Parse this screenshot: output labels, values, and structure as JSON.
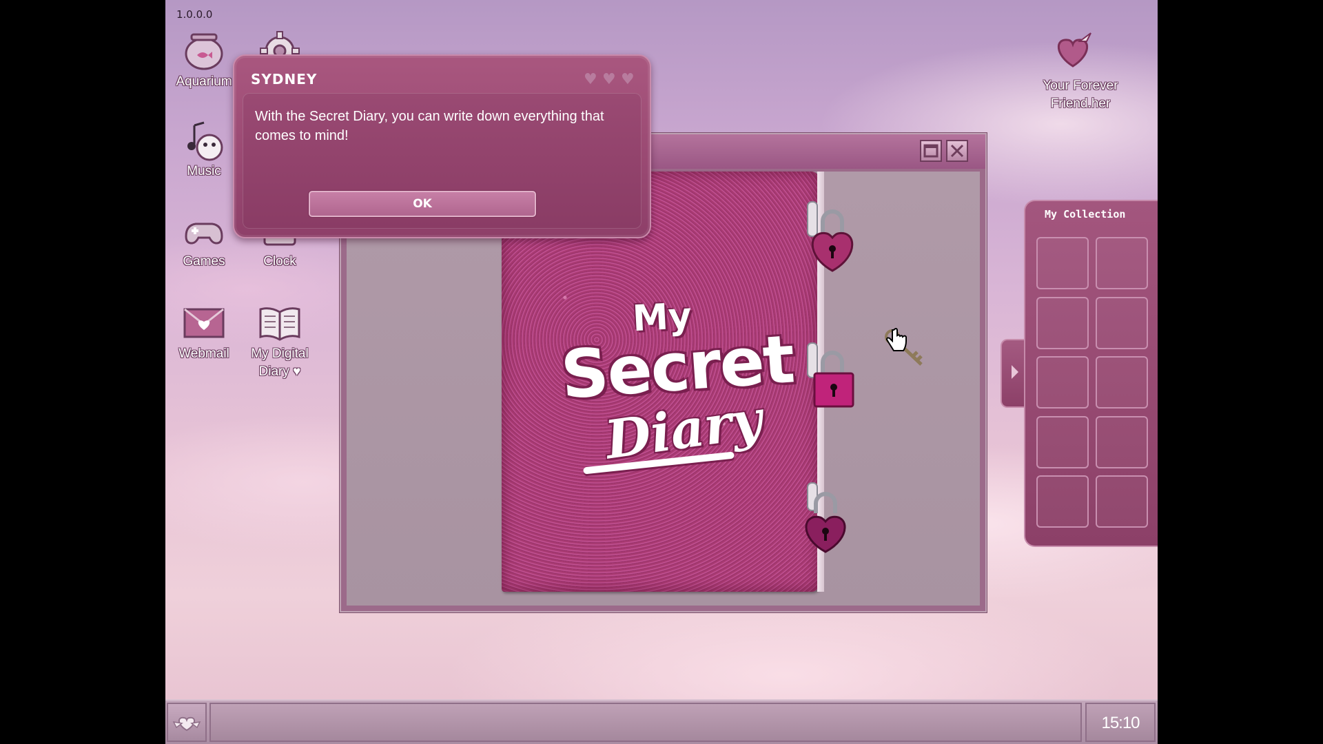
{
  "app": {
    "version": "1.0.0.0"
  },
  "desktop": {
    "icons": [
      {
        "id": "aquarium",
        "label": "Aquarium",
        "icon": "fishbowl-icon"
      },
      {
        "id": "settings",
        "label": "",
        "icon": "gear-icon"
      },
      {
        "id": "music",
        "label": "Music",
        "icon": "music-icon"
      },
      {
        "id": "games",
        "label": "Games",
        "icon": "gamepad-icon"
      },
      {
        "id": "clock",
        "label": "Clock",
        "icon": "clock-icon"
      },
      {
        "id": "webmail",
        "label": "Webmail",
        "icon": "envelope-heart-icon"
      },
      {
        "id": "diary",
        "label": "My Digital Diary ♥",
        "icon": "book-icon"
      }
    ],
    "favorite": {
      "label": "Your Forever Friend.her",
      "icon": "winged-heart-icon"
    }
  },
  "diary_window": {
    "cover": {
      "line1": "My",
      "line2": "Secret",
      "line3": "Diary"
    }
  },
  "dialog": {
    "title": "SYDNEY",
    "message": "With the Secret Diary, you can write down everything that comes to mind!",
    "ok_label": "OK"
  },
  "collection": {
    "title": "My Collection",
    "slot_count": 10
  },
  "taskbar": {
    "time": "15:10"
  },
  "colors": {
    "accent": "#9a4a73",
    "window": "#9c6a8a",
    "taskbar": "#b498ac",
    "text": "#ffffff"
  }
}
